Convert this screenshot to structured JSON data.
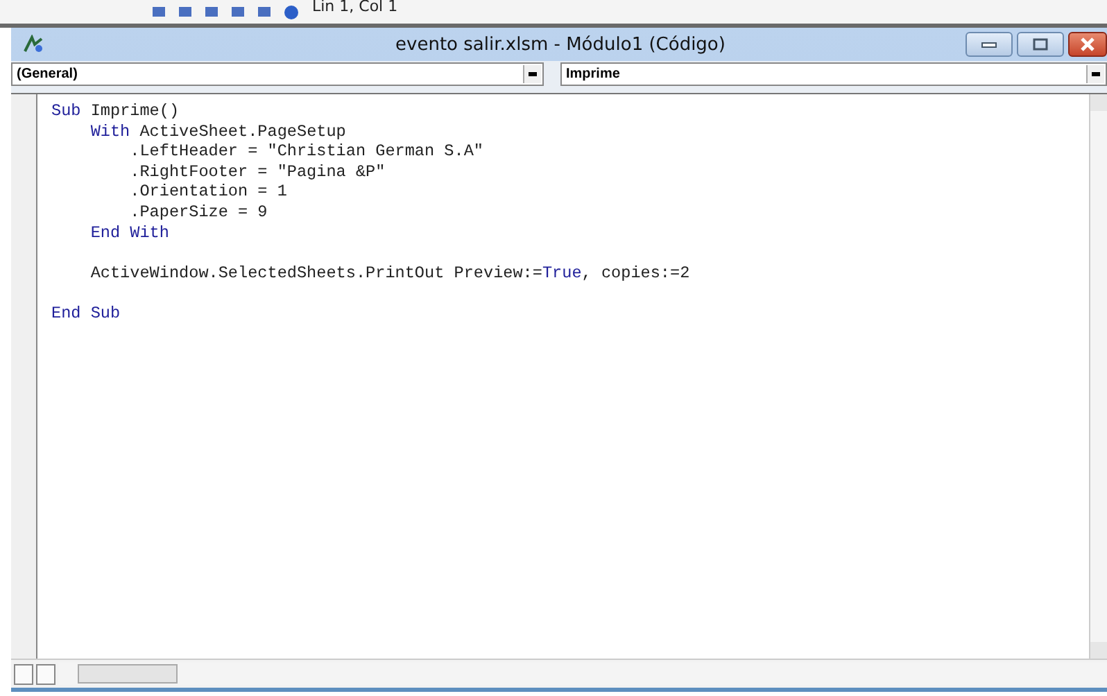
{
  "toolbar": {
    "position": "Lin 1, Col 1"
  },
  "window": {
    "title": "evento salir.xlsm - Módulo1 (Código)"
  },
  "object_dropdown": {
    "value": "(General)"
  },
  "procedure_dropdown": {
    "value": "Imprime"
  },
  "code_lines": [
    {
      "blank_after": false,
      "segments": [
        {
          "kind": "keyword",
          "text": "Sub"
        },
        {
          "kind": "plain",
          "text": " Imprime()"
        }
      ]
    },
    {
      "blank_after": false,
      "segments": [
        {
          "kind": "keyword",
          "text": "    With"
        },
        {
          "kind": "plain",
          "text": " ActiveSheet.PageSetup"
        }
      ]
    },
    {
      "blank_after": false,
      "segments": [
        {
          "kind": "plain",
          "text": "        .LeftHeader = \"Christian German S.A\""
        }
      ]
    },
    {
      "blank_after": false,
      "segments": [
        {
          "kind": "plain",
          "text": "        .RightFooter = \"Pagina &P\""
        }
      ]
    },
    {
      "blank_after": false,
      "segments": [
        {
          "kind": "plain",
          "text": "        .Orientation = 1"
        }
      ]
    },
    {
      "blank_after": false,
      "segments": [
        {
          "kind": "plain",
          "text": "        .PaperSize = 9"
        }
      ]
    },
    {
      "blank_after": true,
      "segments": [
        {
          "kind": "keyword",
          "text": "    End With"
        }
      ]
    },
    {
      "blank_after": true,
      "segments": [
        {
          "kind": "plain",
          "text": "    ActiveWindow.SelectedSheets.PrintOut Preview:="
        },
        {
          "kind": "keyword",
          "text": "True"
        },
        {
          "kind": "plain",
          "text": ", copies:=2"
        }
      ]
    },
    {
      "blank_after": false,
      "segments": [
        {
          "kind": "keyword",
          "text": "End Sub"
        }
      ]
    }
  ]
}
